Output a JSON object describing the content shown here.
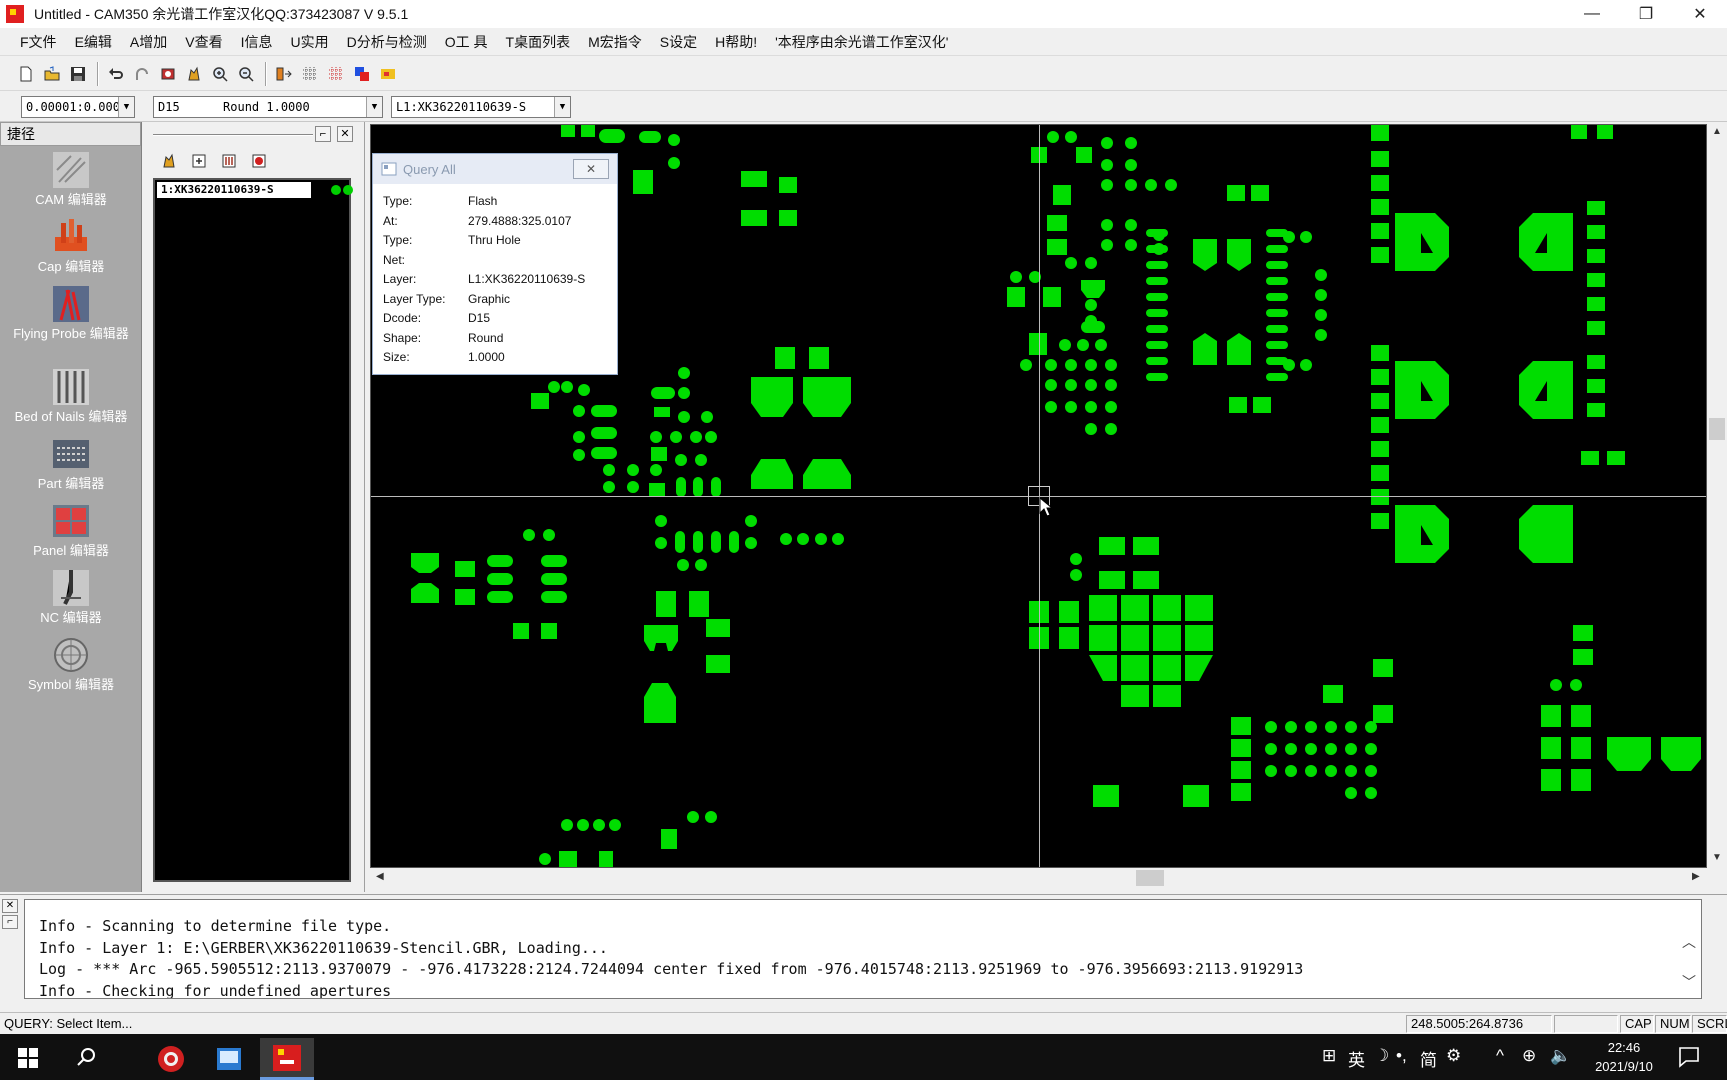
{
  "window": {
    "title": "Untitled - CAM350 余光谱工作室汉化QQ:373423087 V 9.5.1",
    "minimize": "—",
    "restore": "❐",
    "close": "✕"
  },
  "menu": [
    "F文件",
    "E编辑",
    "A增加",
    "V查看",
    "I信息",
    "U实用",
    "D分析与检测",
    "O工 具",
    "T桌面列表",
    "M宏指令",
    "S设定",
    "H帮助!",
    "'本程序由余光谱工作室汉化'"
  ],
  "toolbar": {
    "icons": [
      "new-icon",
      "open-icon",
      "save-icon",
      "undo-icon",
      "redo-icon",
      "redraw-icon",
      "pan-icon",
      "zoom-in-icon",
      "zoom-out-icon",
      "layer-icon",
      "grid-icon",
      "grid-dots-icon",
      "color-icon",
      "highlight-icon"
    ]
  },
  "combos": {
    "grid": "0.00001:0.000",
    "dcode": "D15      Round 1.0000",
    "layer": "L1:XK36220110639-S"
  },
  "palette": {
    "header": "捷径",
    "items": [
      {
        "label": "CAM 编辑器",
        "icon": "cam-editor-icon"
      },
      {
        "label": "Cap 编辑器",
        "icon": "cap-editor-icon"
      },
      {
        "label": "Flying Probe 编辑器",
        "icon": "flying-probe-editor-icon"
      },
      {
        "label": "Bed of Nails 编辑器",
        "icon": "bed-of-nails-editor-icon"
      },
      {
        "label": "Part 编辑器",
        "icon": "part-editor-icon"
      },
      {
        "label": "Panel 编辑器",
        "icon": "panel-editor-icon"
      },
      {
        "label": "NC 编辑器",
        "icon": "nc-editor-icon"
      },
      {
        "label": "Symbol 编辑器",
        "icon": "symbol-editor-icon"
      }
    ]
  },
  "layers_panel": {
    "layer": "1:XK36220110639-S"
  },
  "query": {
    "title": "Query All",
    "close": "✕",
    "rows": [
      {
        "key": "Type:",
        "value": "Flash"
      },
      {
        "key": "At:",
        "value": "279.4888:325.0107"
      },
      {
        "key": "Type:",
        "value": "Thru Hole"
      },
      {
        "key": "Net:",
        "value": ""
      },
      {
        "key": "Layer:",
        "value": "L1:XK36220110639-S"
      },
      {
        "key": "Layer Type:",
        "value": "Graphic"
      },
      {
        "key": "Dcode:",
        "value": "D15"
      },
      {
        "key": "Shape:",
        "value": "Round"
      },
      {
        "key": "Size:",
        "value": "1.0000"
      }
    ]
  },
  "log": {
    "lines": [
      "Info - Scanning to determine file type.",
      "Info - Layer 1: E:\\GERBER\\XK36220110639-Stencil.GBR, Loading...",
      "Log - *** Arc -965.5905512:2113.9370079 - -976.4173228:2124.7244094 center fixed from -976.4015748:2113.9251969 to -976.3956693:2113.9192913",
      "Info - Checking for undefined apertures"
    ]
  },
  "status": {
    "text": "QUERY: Select Item...",
    "coords": "248.5005:264.8736",
    "cap": "CAP",
    "num": "NUM",
    "scrl": "SCRL"
  },
  "taskbar": {
    "tray": [
      "⊞",
      "英",
      "☽",
      "•,",
      "简",
      "⚙",
      "^",
      "⊕",
      "🔈"
    ],
    "time": "22:46",
    "date": "2021/9/10"
  },
  "colors": {
    "pad": "#00dd00",
    "canvas": "#000000"
  }
}
